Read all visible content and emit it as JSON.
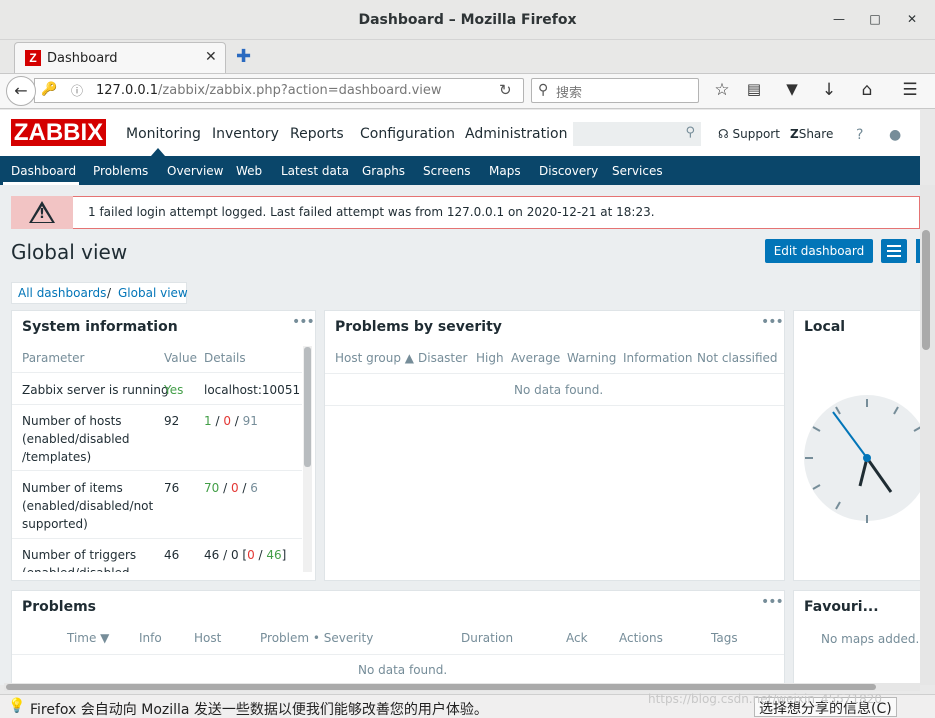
{
  "window": {
    "title": "Dashboard – Mozilla Firefox"
  },
  "browser": {
    "tab_title": "Dashboard",
    "url_host": "127.0.0.1",
    "url_path": "/zabbix/zabbix.php?action=dashboard.view",
    "search_placeholder": "搜索"
  },
  "zabbix": {
    "logo": "ZABBIX",
    "main_menu": [
      "Monitoring",
      "Inventory",
      "Reports",
      "Configuration",
      "Administration"
    ],
    "support": "Support",
    "share": "Share",
    "help": "?",
    "sub_menu": [
      "Dashboard",
      "Problems",
      "Overview",
      "Web",
      "Latest data",
      "Graphs",
      "Screens",
      "Maps",
      "Discovery",
      "Services"
    ]
  },
  "alert": {
    "message": "1 failed login attempt logged. Last failed attempt was from 127.0.0.1 on 2020-12-21 at 18:23."
  },
  "page": {
    "title": "Global view",
    "edit_button": "Edit dashboard",
    "breadcrumb": [
      "All dashboards",
      "Global view"
    ],
    "breadcrumb_sep": "/"
  },
  "system_info": {
    "title": "System information",
    "headers": [
      "Parameter",
      "Value",
      "Details"
    ],
    "rows": [
      {
        "param": "Zabbix server is running",
        "value": "Yes",
        "details": "localhost:10051"
      },
      {
        "param": "Number of hosts (enabled/disabled /templates)",
        "value": "92",
        "d1": "1",
        "d2": "0",
        "d3": "91"
      },
      {
        "param": "Number of items (enabled/disabled/not supported)",
        "value": "76",
        "d1": "70",
        "d2": "0",
        "d3": "6"
      },
      {
        "param": "Number of triggers (enabled/disabled",
        "value": "46",
        "d0": "46 / 0 [",
        "d2": "0",
        "d3": "46",
        "d4": "]"
      }
    ]
  },
  "problems_by_severity": {
    "title": "Problems by severity",
    "headers": [
      "Host group ▲",
      "Disaster",
      "High",
      "Average",
      "Warning",
      "Information",
      "Not classified"
    ],
    "empty": "No data found."
  },
  "local_clock": {
    "title": "Local"
  },
  "problems": {
    "title": "Problems",
    "headers": [
      "Time ▼",
      "Info",
      "Host",
      "Problem • Severity",
      "Duration",
      "Ack",
      "Actions",
      "Tags"
    ],
    "empty": "No data found."
  },
  "favourite_maps": {
    "title": "Favouri...",
    "empty": "No maps added."
  },
  "notification": {
    "text": "Firefox 会自动向 Mozilla 发送一些数据以便我们能够改善您的用户体验。",
    "button": "选择想分享的信息(C)"
  },
  "watermark": "https://blog.csdn.net/weixin_45571820",
  "colors": {
    "accent": "#0275b8",
    "navbar": "#0a466a",
    "brand": "#d40000",
    "ok": "#429e47",
    "problem": "#e33734"
  }
}
